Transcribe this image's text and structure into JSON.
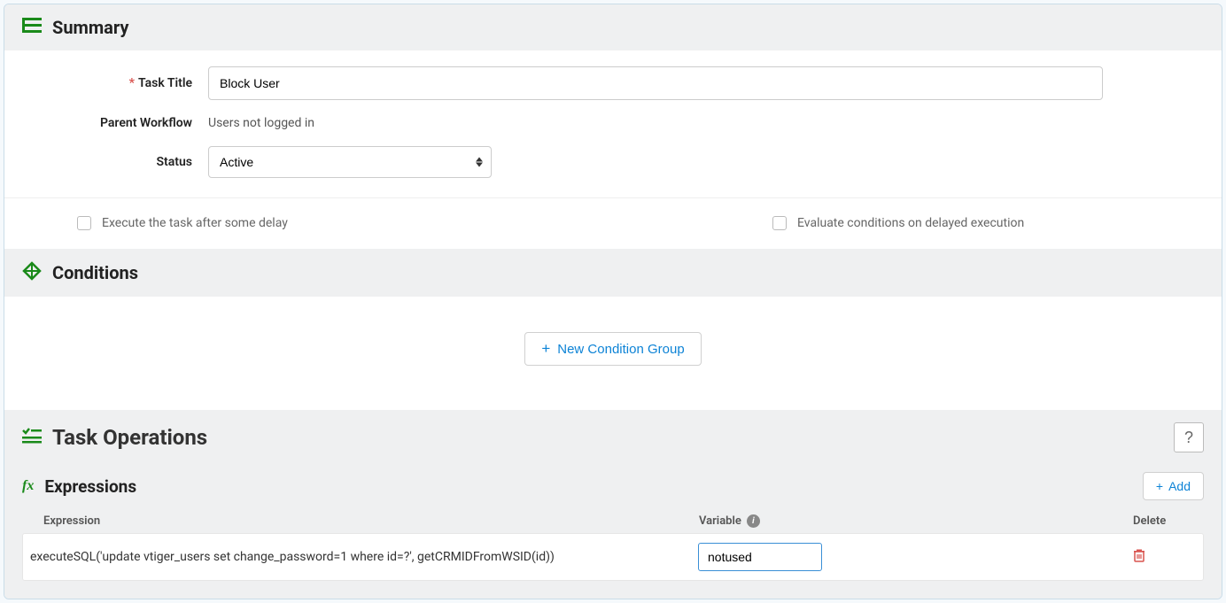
{
  "summary": {
    "heading": "Summary",
    "task_title_label": "Task Title",
    "task_title_value": "Block User",
    "parent_workflow_label": "Parent Workflow",
    "parent_workflow_value": "Users not logged in",
    "status_label": "Status",
    "status_value": "Active",
    "execute_delay_label": "Execute the task after some delay",
    "evaluate_delayed_label": "Evaluate conditions on delayed execution"
  },
  "conditions": {
    "heading": "Conditions",
    "new_group_label": "New Condition Group"
  },
  "operations": {
    "heading": "Task Operations",
    "help_label": "?",
    "expressions_heading": "Expressions",
    "add_label": "Add",
    "columns": {
      "expression": "Expression",
      "variable": "Variable",
      "delete": "Delete"
    },
    "rows": [
      {
        "expression": "executeSQL('update vtiger_users set change_password=1 where id=?', getCRMIDFromWSID(id))",
        "variable": "notused"
      }
    ]
  }
}
